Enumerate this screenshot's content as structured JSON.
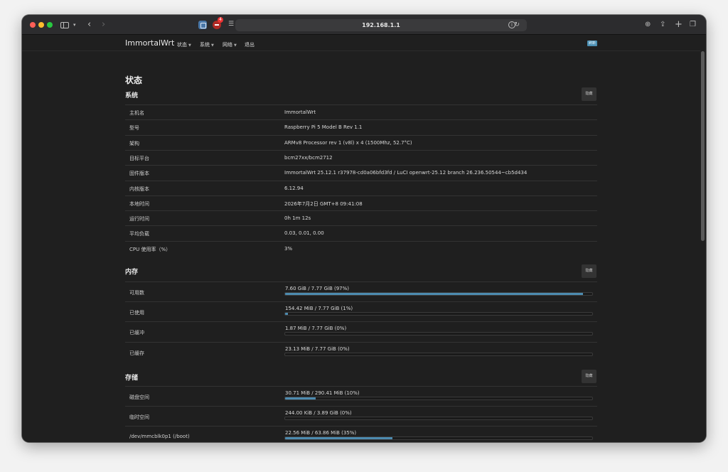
{
  "browser": {
    "url": "192.168.1.1",
    "extension_badge": "4"
  },
  "nav": {
    "brand": "ImmortalWrt",
    "items": [
      "状态",
      "系统",
      "网络",
      "退出"
    ],
    "badge": "刷新"
  },
  "page": {
    "title": "状态"
  },
  "hide_label": "隐藏",
  "system": {
    "title": "系统",
    "rows": [
      {
        "label": "主机名",
        "value": "ImmortalWrt"
      },
      {
        "label": "型号",
        "value": "Raspberry Pi 5 Model B Rev 1.1"
      },
      {
        "label": "架构",
        "value": "ARMv8 Processor rev 1 (v8l) x 4 (1500Mhz, 52.7°C)"
      },
      {
        "label": "目标平台",
        "value": "bcm27xx/bcm2712"
      },
      {
        "label": "固件版本",
        "value": "ImmortalWrt 25.12.1 r37978-cd0a06bfd3fd / LuCI openwrt-25.12 branch 26.236.50544~cb5d434"
      },
      {
        "label": "内核版本",
        "value": "6.12.94"
      },
      {
        "label": "本地时间",
        "value": "2026年7月2日 GMT+8 09:41:08"
      },
      {
        "label": "运行时间",
        "value": "0h 1m 12s"
      },
      {
        "label": "平均负载",
        "value": "0.03, 0.01, 0.00"
      },
      {
        "label": "CPU 使用率（%）",
        "value": "3%"
      }
    ]
  },
  "memory": {
    "title": "内存",
    "rows": [
      {
        "label": "可用数",
        "value": "7.60 GiB / 7.77 GiB (97%)",
        "percent": 97
      },
      {
        "label": "已使用",
        "value": "154.42 MiB / 7.77 GiB (1%)",
        "percent": 1
      },
      {
        "label": "已缓冲",
        "value": "1.87 MiB / 7.77 GiB (0%)",
        "percent": 0
      },
      {
        "label": "已缓存",
        "value": "23.13 MiB / 7.77 GiB (0%)",
        "percent": 0
      }
    ]
  },
  "storage": {
    "title": "存储",
    "rows": [
      {
        "label": "磁盘空间",
        "value": "30.71 MiB / 290.41 MiB (10%)",
        "percent": 10
      },
      {
        "label": "临时空间",
        "value": "244.00 KiB / 3.89 GiB (0%)",
        "percent": 0
      },
      {
        "label": "/dev/mmcblk0p1 (/boot)",
        "value": "22.56 MiB / 63.86 MiB (35%)",
        "percent": 35
      }
    ]
  }
}
